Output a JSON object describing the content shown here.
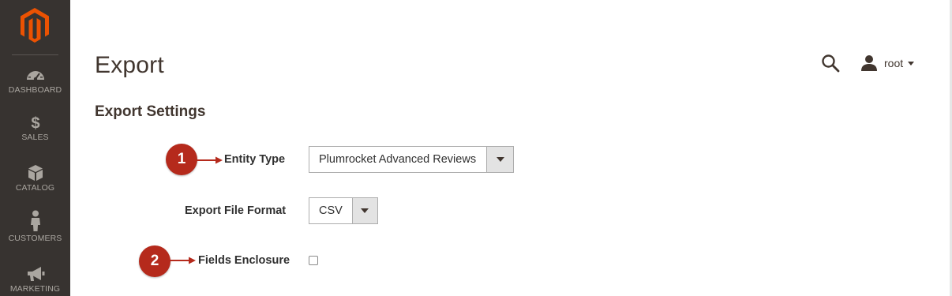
{
  "sidebar": {
    "logo_icon": "magento-logo-icon",
    "items": [
      {
        "label": "DASHBOARD",
        "icon": "speedometer-icon"
      },
      {
        "label": "SALES",
        "icon": "dollar-icon"
      },
      {
        "label": "CATALOG",
        "icon": "box-icon"
      },
      {
        "label": "CUSTOMERS",
        "icon": "person-icon"
      },
      {
        "label": "MARKETING",
        "icon": "megaphone-icon"
      }
    ],
    "bg_color": "#373330",
    "accent_color": "#eb5202"
  },
  "header": {
    "title": "Export",
    "search_icon": "search-icon",
    "user": {
      "name": "root",
      "icon": "user-icon"
    }
  },
  "section": {
    "title": "Export Settings"
  },
  "form": {
    "entity_type": {
      "label": "Entity Type",
      "value": "Plumrocket Advanced Reviews"
    },
    "file_format": {
      "label": "Export File Format",
      "value": "CSV"
    },
    "fields_enclosure": {
      "label": "Fields Enclosure",
      "checked": false
    }
  },
  "annotations": [
    {
      "number": "1"
    },
    {
      "number": "2"
    }
  ],
  "colors": {
    "marker": "#b52a1c",
    "text": "#41362f"
  }
}
